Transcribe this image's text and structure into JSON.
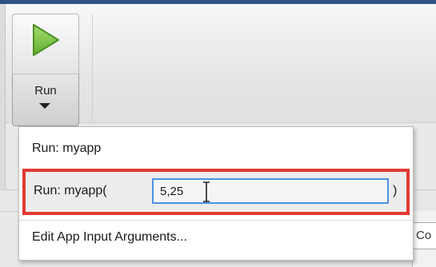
{
  "toolstrip": {
    "run_button": {
      "icon": "play-icon",
      "icon_color": "#7bc441",
      "label": "Run"
    }
  },
  "menu": {
    "items": [
      {
        "label": "Run: myapp"
      },
      {
        "label": "Run: myapp(",
        "input_value": "5,25",
        "suffix": ")",
        "highlight_color": "#e13a32"
      },
      {
        "label": "Edit App Input Arguments..."
      }
    ]
  },
  "side_field": {
    "text": "Co"
  },
  "colors": {
    "accent": "#4c92e0",
    "highlight": "#e13a32",
    "play": "#7bc441"
  }
}
